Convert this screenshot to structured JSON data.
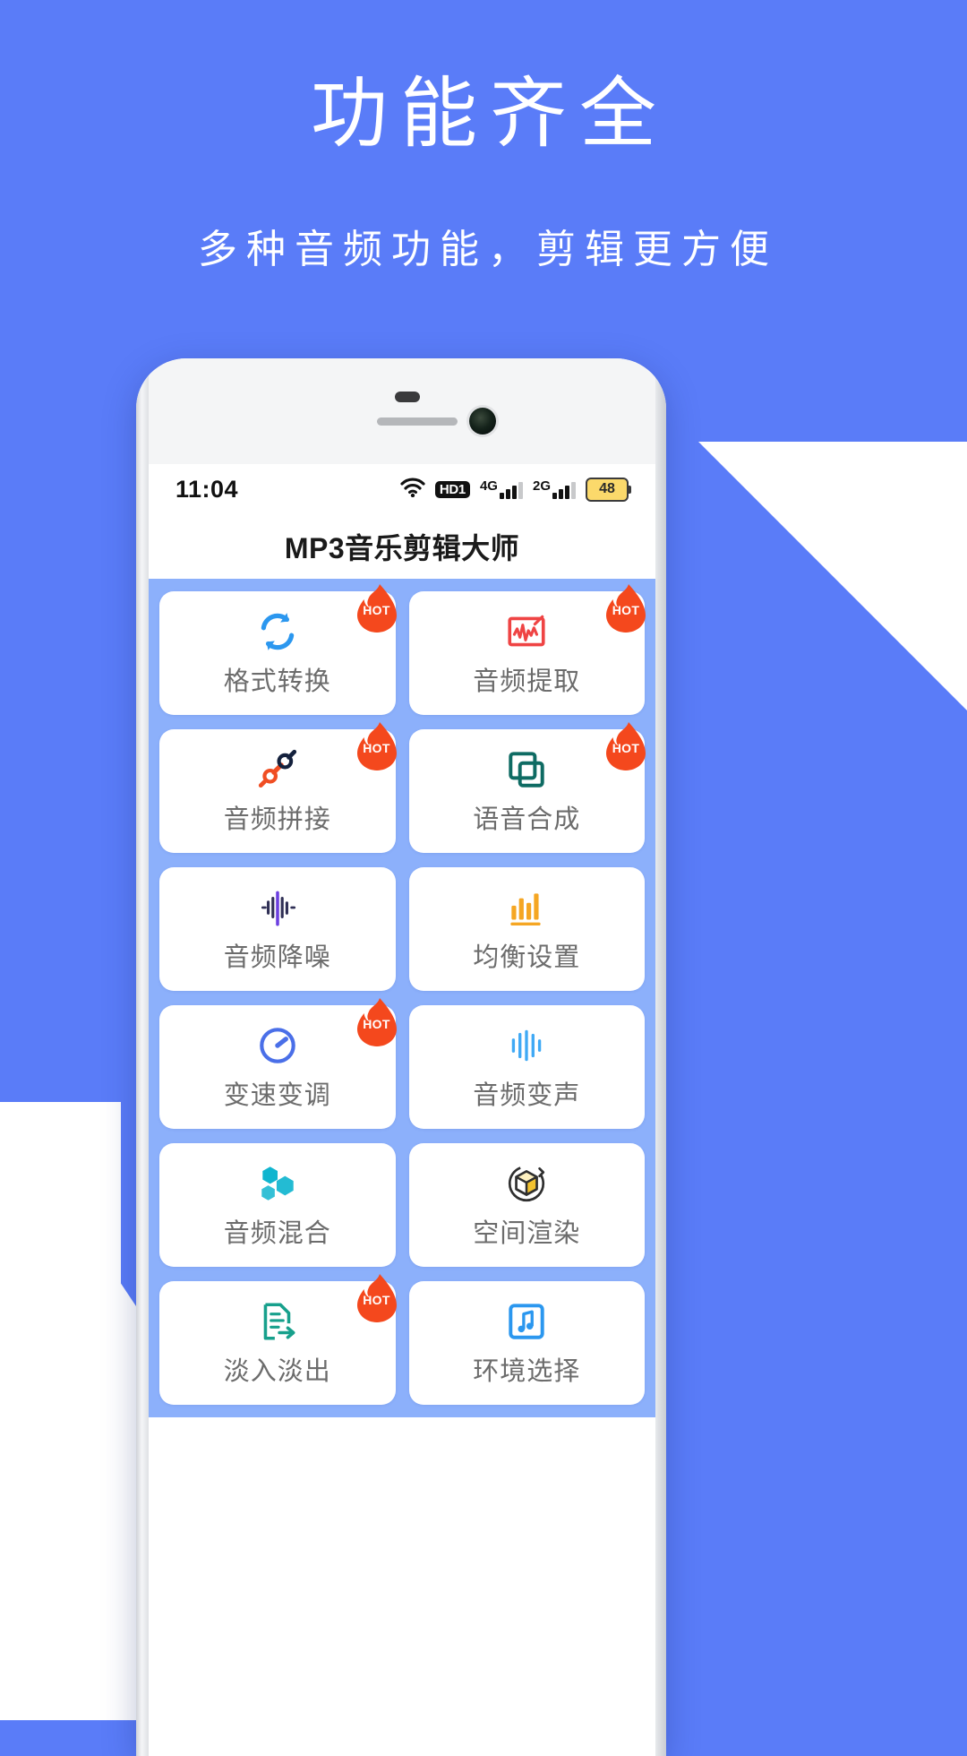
{
  "promo": {
    "title": "功能齐全",
    "subtitle": "多种音频功能，剪辑更方便",
    "bg_color": "#5a7cf8",
    "text_color": "#ffffff"
  },
  "phone": {
    "statusbar": {
      "time": "11:04",
      "wifi_icon": "wifi-icon",
      "hd_label": "HD1",
      "sim1_label": "4G",
      "sim2_label": "2G",
      "battery_level": "48",
      "battery_color": "#fbd96b"
    },
    "app": {
      "title": "MP3音乐剪辑大师",
      "grid_bg": "#8cb0fb",
      "hot_badge_label": "HOT",
      "hot_badge_color": "#f4481d",
      "features": [
        {
          "label": "格式转换",
          "icon": "sync-arrows-icon",
          "icon_color": "#2b97ef",
          "hot": true
        },
        {
          "label": "音频提取",
          "icon": "waveform-frame-icon",
          "icon_color": "#ef4444",
          "hot": true
        },
        {
          "label": "音频拼接",
          "icon": "plug-connector-icon",
          "icon_color": "#f04e23",
          "hot": true
        },
        {
          "label": "语音合成",
          "icon": "layers-square-icon",
          "icon_color": "#0e6b63",
          "hot": true
        },
        {
          "label": "音频降噪",
          "icon": "audio-waveform-icon",
          "icon_color": "#2f2f55",
          "hot": false
        },
        {
          "label": "均衡设置",
          "icon": "equalizer-bars-icon",
          "icon_color": "#f5a623",
          "hot": false
        },
        {
          "label": "变速变调",
          "icon": "speedometer-icon",
          "icon_color": "#4a6fe8",
          "hot": true
        },
        {
          "label": "音频变声",
          "icon": "voice-bars-icon",
          "icon_color": "#3fa9f5",
          "hot": false
        },
        {
          "label": "音频混合",
          "icon": "hexagon-mix-icon",
          "icon_color": "#10b5cf",
          "hot": false
        },
        {
          "label": "空间渲染",
          "icon": "cube-rotate-icon",
          "icon_color": "#f2c230",
          "hot": false
        },
        {
          "label": "淡入淡出",
          "icon": "fade-document-icon",
          "icon_color": "#17a08c",
          "hot": true
        },
        {
          "label": "环境选择",
          "icon": "music-note-square-icon",
          "icon_color": "#2b97ef",
          "hot": false
        }
      ]
    }
  }
}
